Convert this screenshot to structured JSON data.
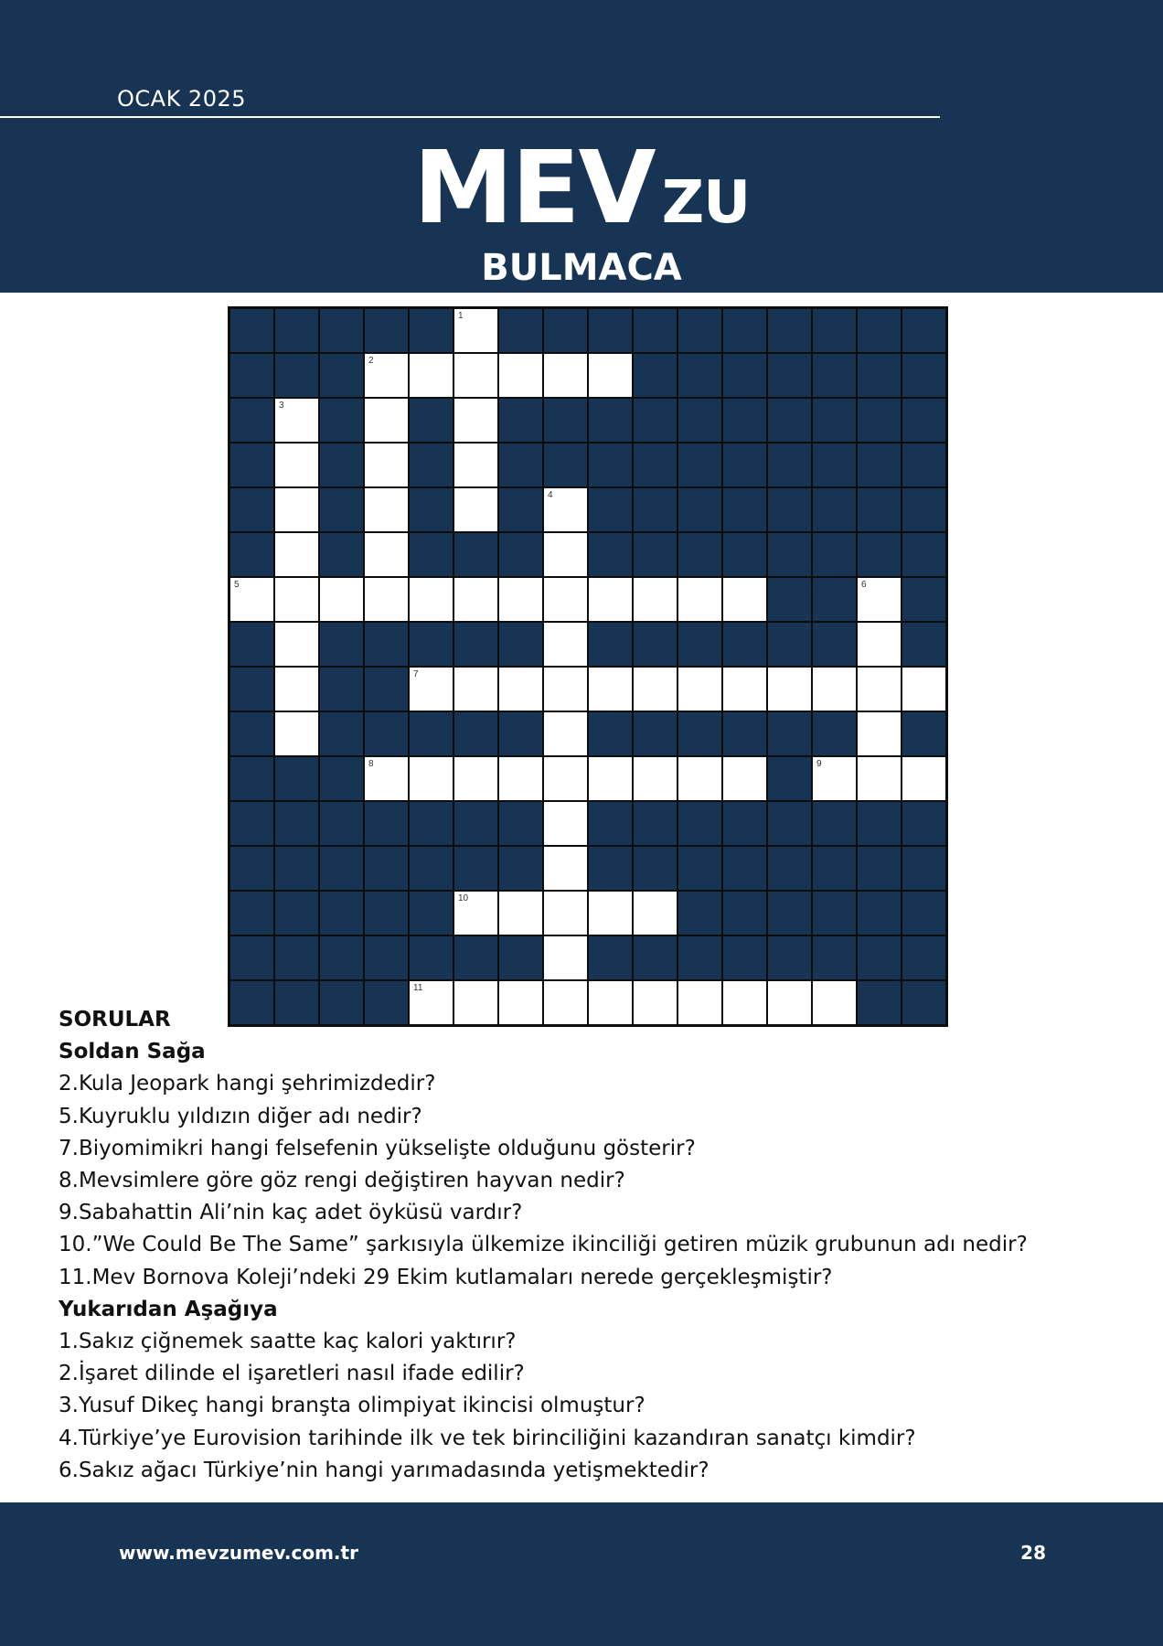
{
  "header": {
    "issue_date": "OCAK 2025",
    "logo_main": "MEV",
    "logo_sub": "ZU",
    "title": "BULMACA"
  },
  "crossword": {
    "columns": 16,
    "rows": [
      ".....#..........",
      "...######.......",
      ".#.#.#..........",
      ".#.#.#..........",
      ".#.#.#.#........",
      ".#.#...#........",
      "############..#.",
      ".#.....#......#.",
      ".#..############",
      ".#.....#......#.",
      "...#########.###",
      ".......#........",
      ".......#........",
      ".....#####......",
      ".......#........",
      "....##########.."
    ],
    "numbers": [
      {
        "row": 0,
        "col": 5,
        "n": "1"
      },
      {
        "row": 1,
        "col": 3,
        "n": "2"
      },
      {
        "row": 2,
        "col": 1,
        "n": "3"
      },
      {
        "row": 4,
        "col": 7,
        "n": "4"
      },
      {
        "row": 6,
        "col": 0,
        "n": "5"
      },
      {
        "row": 6,
        "col": 14,
        "n": "6"
      },
      {
        "row": 8,
        "col": 4,
        "n": "7"
      },
      {
        "row": 10,
        "col": 3,
        "n": "8"
      },
      {
        "row": 10,
        "col": 13,
        "n": "9"
      },
      {
        "row": 13,
        "col": 5,
        "n": "10"
      },
      {
        "row": 15,
        "col": 4,
        "n": "11"
      }
    ]
  },
  "questions": {
    "title": "SORULAR",
    "across_title": "Soldan Sağa",
    "across": [
      "2.Kula Jeopark hangi şehrimizdedir?",
      "5.Kuyruklu yıldızın diğer adı nedir?",
      "7.Biyomimikri hangi felsefenin yükselişte olduğunu gösterir?",
      "8.Mevsimlere göre göz rengi değiştiren hayvan nedir?",
      "9.Sabahattin Ali’nin kaç adet öyküsü vardır?",
      "10.”We Could Be The Same” şarkısıyla ülkemize ikinciliği getiren müzik grubunun adı nedir?",
      "11.Mev Bornova Koleji’ndeki 29 Ekim kutlamaları nerede gerçekleşmiştir?"
    ],
    "down_title": "Yukarıdan Aşağıya",
    "down": [
      "1.Sakız çiğnemek saatte kaç kalori yaktırır?",
      "2.İşaret dilinde el işaretleri nasıl ifade edilir?",
      "3.Yusuf Dikeç hangi branşta olimpiyat ikincisi olmuştur?",
      "4.Türkiye’ye Eurovision tarihinde ilk ve tek birinciliğini kazandıran sanatçı kimdir?",
      "6.Sakız ağacı Türkiye’nin hangi yarımadasında yetişmektedir?"
    ]
  },
  "footer": {
    "url": "www.mevzumev.com.tr",
    "page_number": "28"
  },
  "colors": {
    "navy": "#183455",
    "white": "#ffffff"
  }
}
